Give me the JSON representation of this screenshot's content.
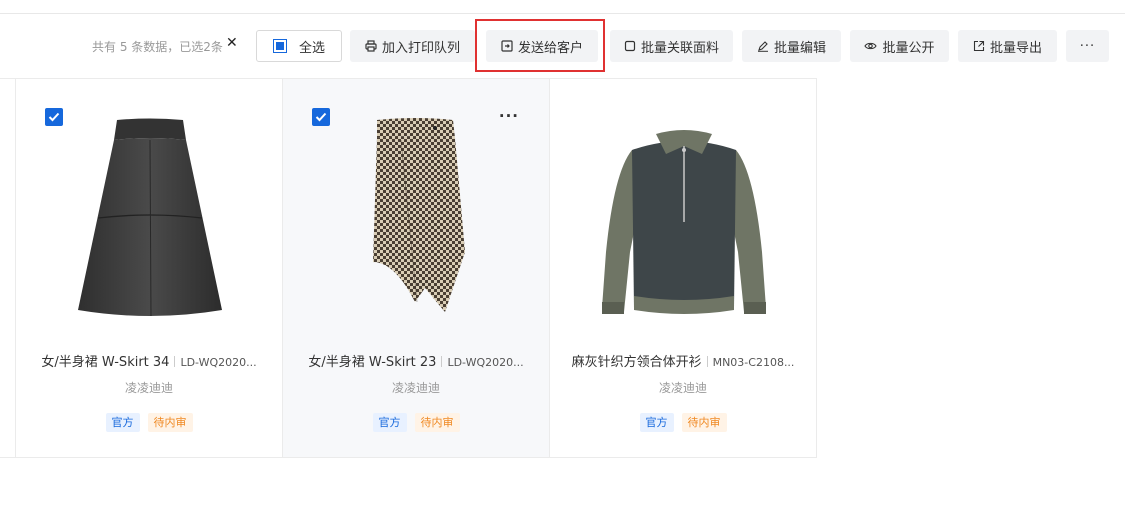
{
  "toolbar": {
    "count_text": "共有 5 条数据，已选2条",
    "clear_symbol": "✕",
    "buttons": {
      "select_all": "全选",
      "print_queue": "加入打印队列",
      "send_to_customer": "发送给客户",
      "link_fabric": "批量关联面料",
      "batch_edit": "批量编辑",
      "batch_public": "批量公开",
      "batch_export": "批量导出",
      "more": "···"
    }
  },
  "cards": [
    {
      "title": "女/半身裙 W-Skirt 34",
      "code": "LD-WQ2020...",
      "brand": "凌凌迪迪",
      "checked": true,
      "tags": [
        "官方",
        "待内审"
      ],
      "image": "black-a-line-skirt"
    },
    {
      "title": "女/半身裙 W-Skirt 23",
      "code": "LD-WQ2020...",
      "brand": "凌凌迪迪",
      "checked": true,
      "more": "···",
      "tags": [
        "官方",
        "待内审"
      ],
      "image": "houndstooth-wrap-skirt"
    },
    {
      "title": "麻灰针织方领合体开衫",
      "code": "MN03-C2108...",
      "brand": "凌凌迪迪",
      "checked": false,
      "tags": [
        "官方",
        "待内审"
      ],
      "image": "knit-zip-sweater"
    }
  ],
  "colors": {
    "primary": "#1668dc",
    "highlight_border": "#e03131",
    "tag_official": "#1668dc",
    "tag_pending": "#f08a24"
  }
}
